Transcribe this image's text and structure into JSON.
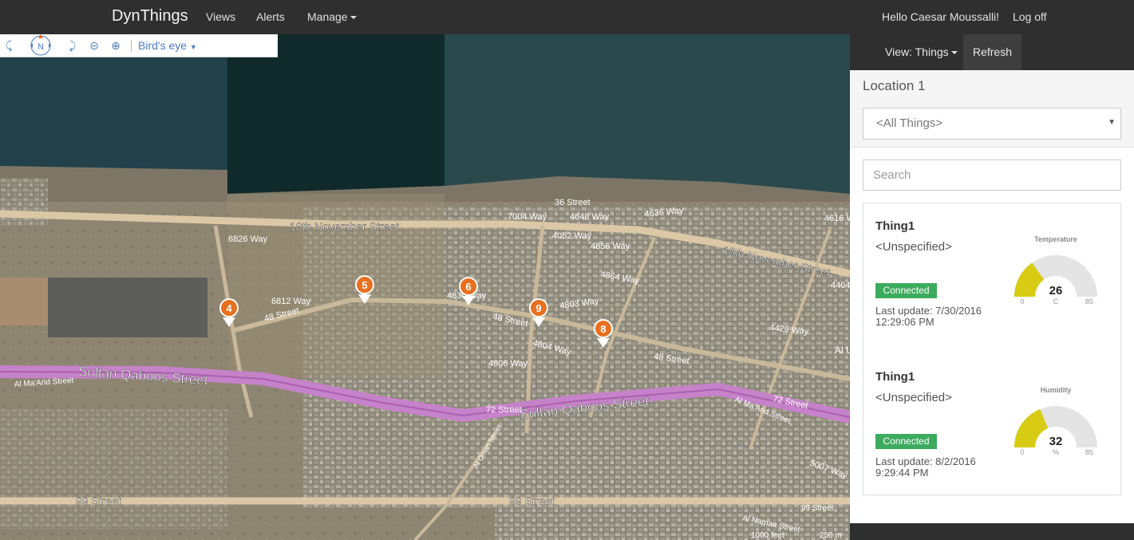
{
  "navbar": {
    "brand": "DynThings",
    "items": [
      {
        "label": "Views"
      },
      {
        "label": "Alerts"
      },
      {
        "label": "Manage"
      }
    ],
    "greeting": "Hello Caesar Moussalli!",
    "logoff": "Log off"
  },
  "map": {
    "toolbar": {
      "compass_label": "N",
      "mode_label": "Bird's eye"
    },
    "streets": [
      {
        "label": "18th November Street"
      },
      {
        "label": "18th November Street"
      },
      {
        "label": "Sultan Qaboos Street"
      },
      {
        "label": "Sultan Qaboos Street"
      },
      {
        "label": "99 Street"
      },
      {
        "label": "99 Street"
      },
      {
        "label": "48 Street"
      },
      {
        "label": "48 Street"
      },
      {
        "label": "48 Street"
      },
      {
        "label": "72 Street"
      },
      {
        "label": "72 Street"
      },
      {
        "label": "99 Street"
      },
      {
        "label": "Al Ma'Arid Street"
      },
      {
        "label": "Al Ma'Arid Street"
      },
      {
        "label": "36 Street"
      },
      {
        "label": "7004 Way"
      },
      {
        "label": "4648 Way"
      },
      {
        "label": "4636 Way"
      },
      {
        "label": "4616 W"
      },
      {
        "label": "6826 Way"
      },
      {
        "label": "4052 Way"
      },
      {
        "label": "4856 Way"
      },
      {
        "label": "4864 Way"
      },
      {
        "label": "6812 Way"
      },
      {
        "label": "4830 Way"
      },
      {
        "label": "4803 Way"
      },
      {
        "label": "4804 Way"
      },
      {
        "label": "4806 Way"
      },
      {
        "label": "4429 Way"
      },
      {
        "label": "5007 Way"
      },
      {
        "label": "Al Oman Street"
      },
      {
        "label": "Al Namaa Street"
      },
      {
        "label": "4404"
      },
      {
        "label": "Al U"
      }
    ],
    "pins": [
      {
        "label": "4"
      },
      {
        "label": "5"
      },
      {
        "label": "6"
      },
      {
        "label": "9"
      },
      {
        "label": "8"
      }
    ],
    "scale": [
      "1000 feet",
      "250 m"
    ]
  },
  "sidebar": {
    "view_label": "View: Things",
    "refresh_label": "Refresh",
    "location_title": "Location 1",
    "things_select": "<All Things>",
    "search_placeholder": "Search",
    "cards": [
      {
        "name": "Thing1",
        "location": "<Unspecified>",
        "status": "Connected",
        "last_update": "Last update: 7/30/2016 12:29:06 PM",
        "gauge": {
          "title": "Temperature",
          "value": "26",
          "unit": "C",
          "min": "0",
          "max": "85",
          "fraction": 0.306
        }
      },
      {
        "name": "Thing1",
        "location": "<Unspecified>",
        "status": "Connected",
        "last_update": "Last update: 8/2/2016 9:29:44 PM",
        "gauge": {
          "title": "Humidity",
          "value": "32",
          "unit": "%",
          "min": "0",
          "max": "85",
          "fraction": 0.376
        }
      }
    ]
  },
  "colors": {
    "navbar": "#2f2f2f",
    "accent": "#4a7cc7",
    "connected": "#3cab5e",
    "gauge_fill": "#d7cc13",
    "gauge_track": "#e4e4e4",
    "pin": "#e8701f",
    "highway": "#c682c9"
  }
}
